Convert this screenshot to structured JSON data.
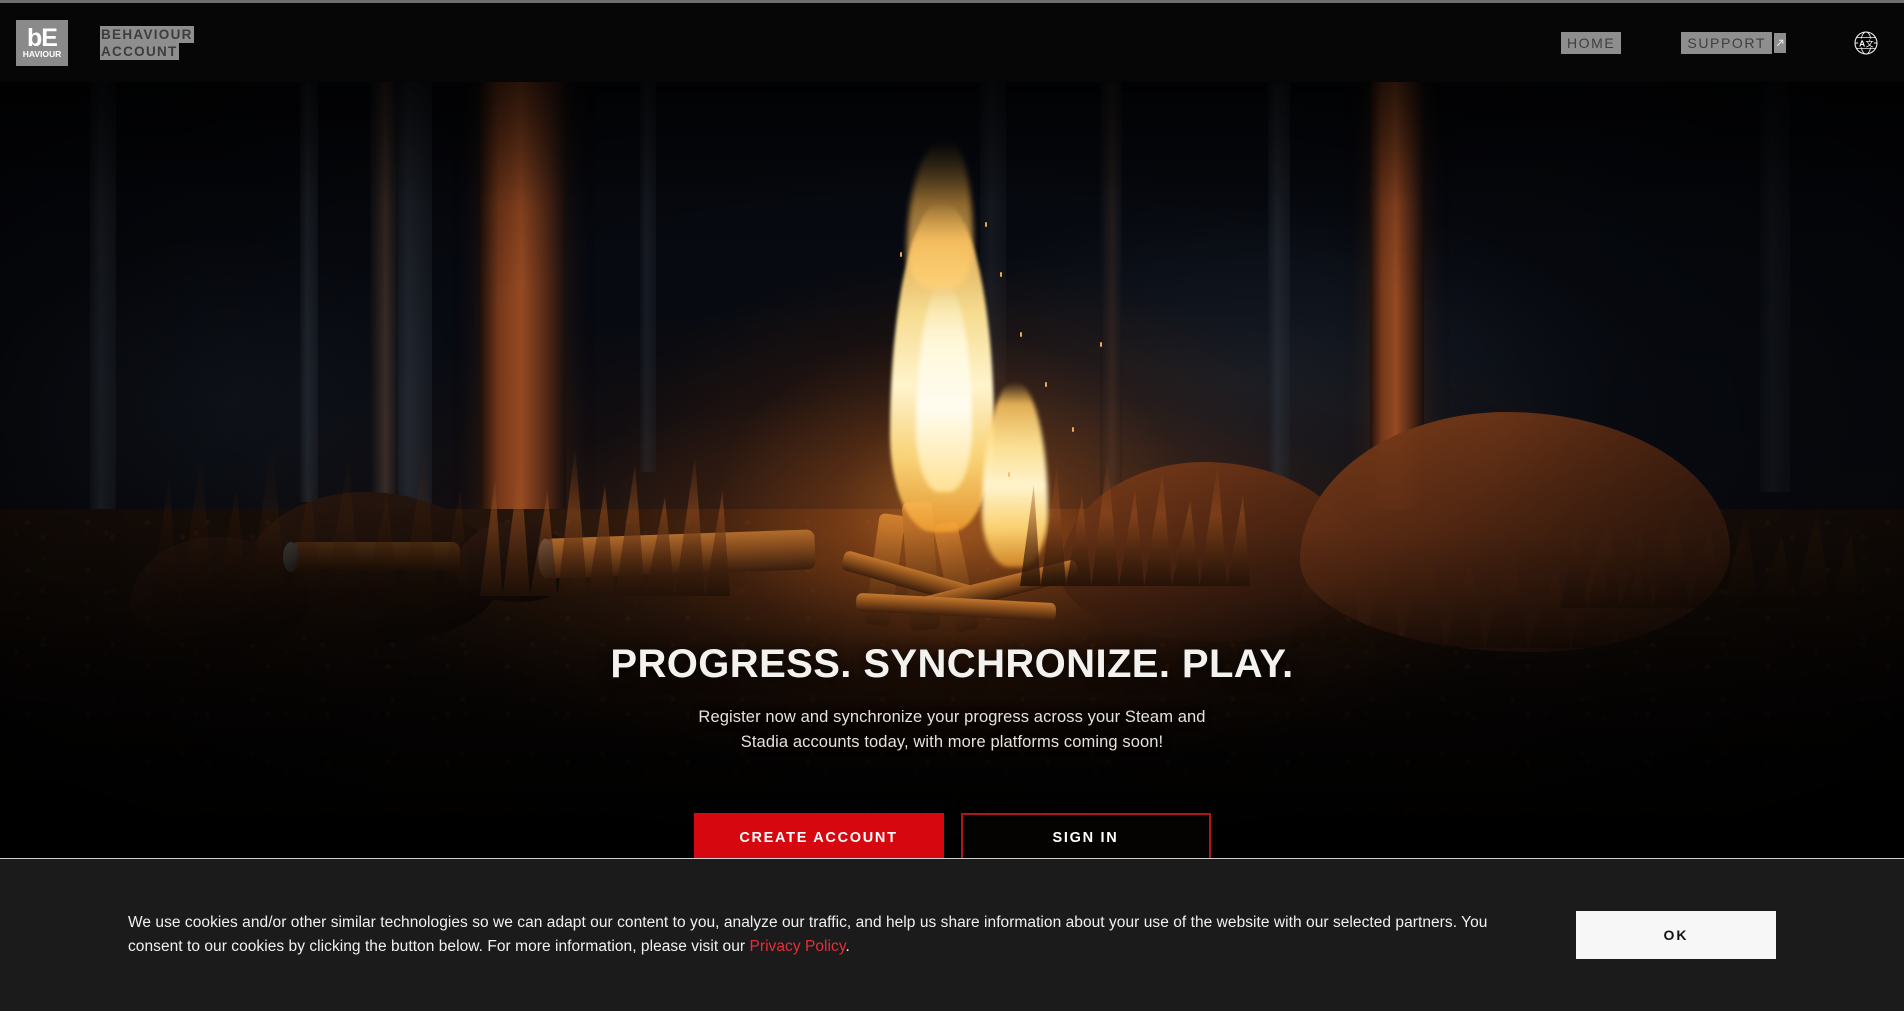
{
  "header": {
    "logo": {
      "mark_top": "bE",
      "mark_bottom": "HAVIOUR",
      "icon": "behaviour-logo-icon"
    },
    "brand_line1": "BEHAVIOUR",
    "brand_line2": "ACCOUNT",
    "nav": {
      "home": "HOME",
      "support": "SUPPORT",
      "support_icon": "external-link-icon",
      "language_icon": "globe-language-icon"
    }
  },
  "hero": {
    "title": "PROGRESS. SYNCHRONIZE. PLAY.",
    "subtitle_line1": "Register now and synchronize your progress across your Steam and",
    "subtitle_line2": "Stadia accounts today, with more platforms coming soon!",
    "create_account": "CREATE ACCOUNT",
    "sign_in": "SIGN IN",
    "scene": "campfire-in-dark-forest"
  },
  "cookie_banner": {
    "text_part1": "We use cookies and/or other similar technologies so we can adapt our content to you, analyze our traffic, and help us share information about your use of the website with our selected partners. You consent to our cookies by clicking the button below. For more information, please visit our ",
    "link_label": "Privacy Policy",
    "text_part2": ".",
    "ok_label": "OK"
  },
  "colors": {
    "accent_red": "#D6070E",
    "link_red": "#e2303a",
    "banner_bg": "#1b1b1b",
    "header_bg": "#060606"
  }
}
